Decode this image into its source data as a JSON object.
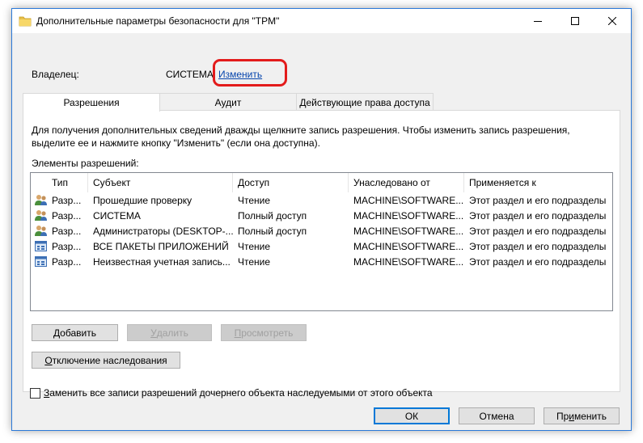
{
  "window": {
    "title": "Дополнительные параметры безопасности  для \"TPM\""
  },
  "owner": {
    "label": "Владелец:",
    "value": "СИСТЕМА",
    "change_link": "Изменить"
  },
  "tabs": [
    {
      "label": "Разрешения",
      "active": true
    },
    {
      "label": "Аудит",
      "active": false
    },
    {
      "label": "Действующие права доступа",
      "active": false
    }
  ],
  "info_text": "Для получения дополнительных сведений дважды щелкните запись разрешения. Чтобы изменить запись разрешения, выделите ее и нажмите кнопку \"Изменить\" (если она доступна).",
  "elements_label": "Элементы разрешений:",
  "columns": [
    "Тип",
    "Субъект",
    "Доступ",
    "Унаследовано от",
    "Применяется к"
  ],
  "rows": [
    {
      "icon": "users-icon",
      "type": "Разр...",
      "subject": "Прошедшие проверку",
      "access": "Чтение",
      "inherited": "MACHINE\\SOFTWARE...",
      "applies": "Этот раздел и его подразделы"
    },
    {
      "icon": "users-icon",
      "type": "Разр...",
      "subject": "СИСТЕМА",
      "access": "Полный доступ",
      "inherited": "MACHINE\\SOFTWARE...",
      "applies": "Этот раздел и его подразделы"
    },
    {
      "icon": "users-icon",
      "type": "Разр...",
      "subject": "Администраторы (DESKTOP-...",
      "access": "Полный доступ",
      "inherited": "MACHINE\\SOFTWARE...",
      "applies": "Этот раздел и его подразделы"
    },
    {
      "icon": "app-package-icon",
      "type": "Разр...",
      "subject": "ВСЕ ПАКЕТЫ ПРИЛОЖЕНИЙ",
      "access": "Чтение",
      "inherited": "MACHINE\\SOFTWARE...",
      "applies": "Этот раздел и его подразделы"
    },
    {
      "icon": "app-package-icon",
      "type": "Разр...",
      "subject": "Неизвестная учетная запись...",
      "access": "Чтение",
      "inherited": "MACHINE\\SOFTWARE...",
      "applies": "Этот раздел и его подразделы"
    }
  ],
  "buttons": {
    "add": {
      "mnemonic": "Д",
      "rest": "обавить"
    },
    "remove": {
      "mnemonic": "У",
      "rest": "далить"
    },
    "view": {
      "mnemonic": "П",
      "rest": "росмотреть"
    },
    "disable_inheritance": {
      "mnemonic": "О",
      "rest": "тключение наследования"
    },
    "ok": "ОК",
    "cancel": "Отмена",
    "apply": {
      "pre": "Пр",
      "mnemonic": "и",
      "rest": "менить"
    }
  },
  "replace_checkbox": {
    "mnemonic": "З",
    "rest": "аменить все записи разрешений дочернего объекта наследуемыми от этого объекта",
    "checked": false
  }
}
